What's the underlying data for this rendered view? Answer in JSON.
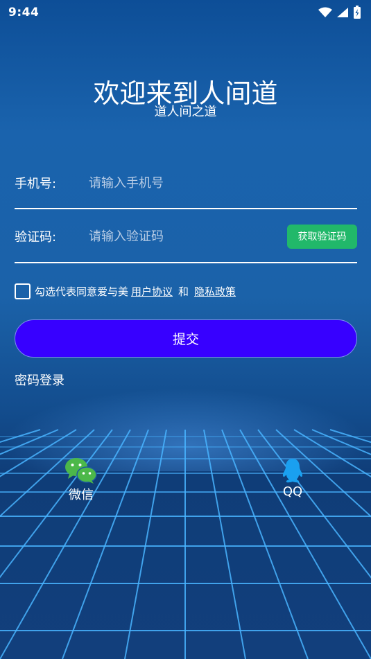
{
  "status_bar": {
    "time": "9:44",
    "icons": [
      "wifi-icon",
      "signal-icon",
      "battery-icon"
    ]
  },
  "header": {
    "title": "欢迎来到人间道",
    "subtitle": "道人间之道"
  },
  "form": {
    "phone": {
      "label": "手机号:",
      "placeholder": "请输入手机号",
      "value": ""
    },
    "code": {
      "label": "验证码:",
      "placeholder": "请输入验证码",
      "value": "",
      "button": "获取验证码"
    }
  },
  "agreement": {
    "checked": false,
    "text": "勾选代表同意爱与美",
    "user_agreement": "用户协议",
    "and": "和",
    "privacy_policy": "隐私政策"
  },
  "submit_label": "提交",
  "password_login": "密码登录",
  "social": {
    "wechat_label": "微信",
    "qq_label": "QQ"
  },
  "colors": {
    "submit": "#3700ff",
    "get_code": "#21b86a",
    "wechat": "#4cb84a",
    "qq": "#1aa0f0"
  }
}
